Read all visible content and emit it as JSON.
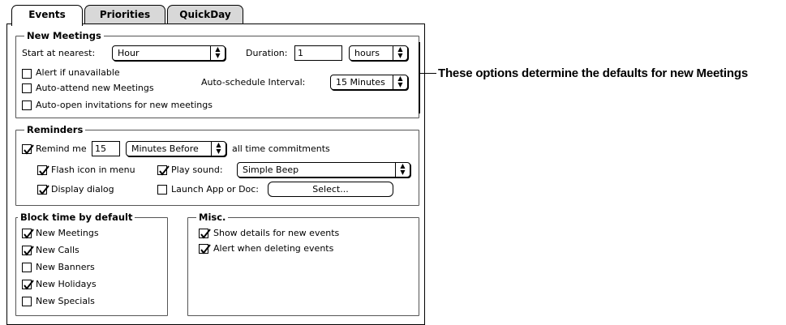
{
  "tabs": [
    {
      "label": "Events",
      "active": true
    },
    {
      "label": "Priorities",
      "active": false
    },
    {
      "label": "QuickDay",
      "active": false
    }
  ],
  "new_meetings": {
    "legend": "New Meetings",
    "start_label": "Start at nearest:",
    "start_value": "Hour",
    "duration_label": "Duration:",
    "duration_value": "1",
    "duration_unit": "hours",
    "alert_unavailable": {
      "label": "Alert if unavailable",
      "checked": false
    },
    "auto_attend": {
      "label": "Auto-attend new Meetings",
      "checked": false
    },
    "auto_open": {
      "label": "Auto-open invitations for new meetings",
      "checked": false
    },
    "interval_label": "Auto-schedule Interval:",
    "interval_value": "15 Minutes"
  },
  "reminders": {
    "legend": "Reminders",
    "remind_me": {
      "label": "Remind me",
      "checked": true
    },
    "remind_value": "15",
    "remind_unit": "Minutes Before",
    "remind_suffix": "all time commitments",
    "flash_icon": {
      "label": "Flash icon in menu",
      "checked": true
    },
    "play_sound": {
      "label": "Play sound:",
      "checked": true
    },
    "sound_value": "Simple Beep",
    "display_dialog": {
      "label": "Display dialog",
      "checked": true
    },
    "launch_app": {
      "label": "Launch App or Doc:",
      "checked": false
    },
    "select_button": "Select..."
  },
  "block_time": {
    "legend": "Block time by default",
    "items": [
      {
        "label": "New Meetings",
        "checked": true
      },
      {
        "label": "New Calls",
        "checked": true
      },
      {
        "label": "New Banners",
        "checked": false
      },
      {
        "label": "New Holidays",
        "checked": true
      },
      {
        "label": "New Specials",
        "checked": false
      }
    ]
  },
  "misc": {
    "legend": "Misc.",
    "items": [
      {
        "label": "Show details for new events",
        "checked": true
      },
      {
        "label": "Alert when deleting events",
        "checked": true
      }
    ]
  },
  "callout": "These options determine the defaults for new Meetings"
}
